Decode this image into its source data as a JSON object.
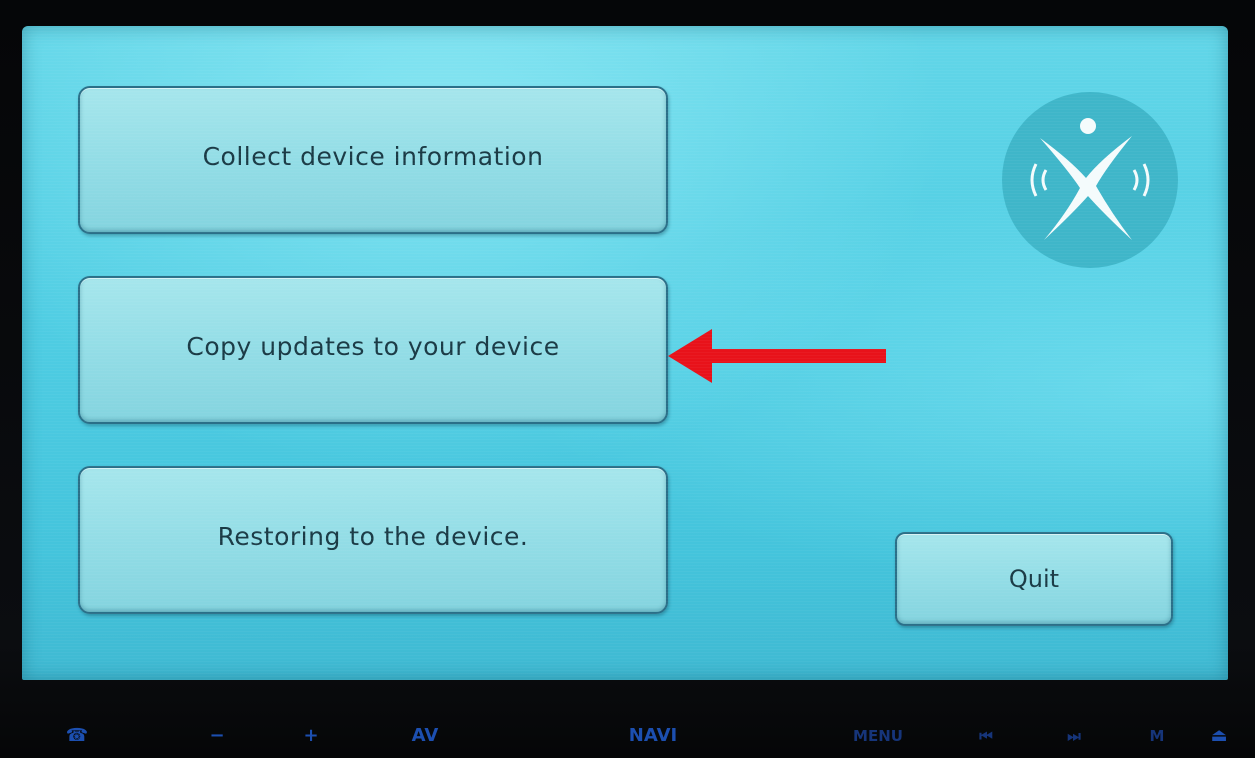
{
  "menu": {
    "collect_label": "Collect device information",
    "copy_label": "Copy updates to your device",
    "restore_label": "Restoring to the device."
  },
  "quit_label": "Quit",
  "logo_icon": "x-figure-broadcast-icon",
  "annotation": {
    "arrow_icon": "red-left-arrow-icon",
    "arrow_color": "#e8121a"
  },
  "hardware_bar": {
    "phone": "☎",
    "minus": "−",
    "plus": "+",
    "av": "AV",
    "navi": "NAVI",
    "menu": "MENU",
    "prev": "⏮",
    "next": "⏭",
    "m": "M",
    "eject": "⏏"
  },
  "colors": {
    "screen": "#4fcde3",
    "button_fill": "#93dde6",
    "button_border": "#2a6f88",
    "text": "#1a3a45",
    "hardware_text": "#1c4fb0"
  }
}
